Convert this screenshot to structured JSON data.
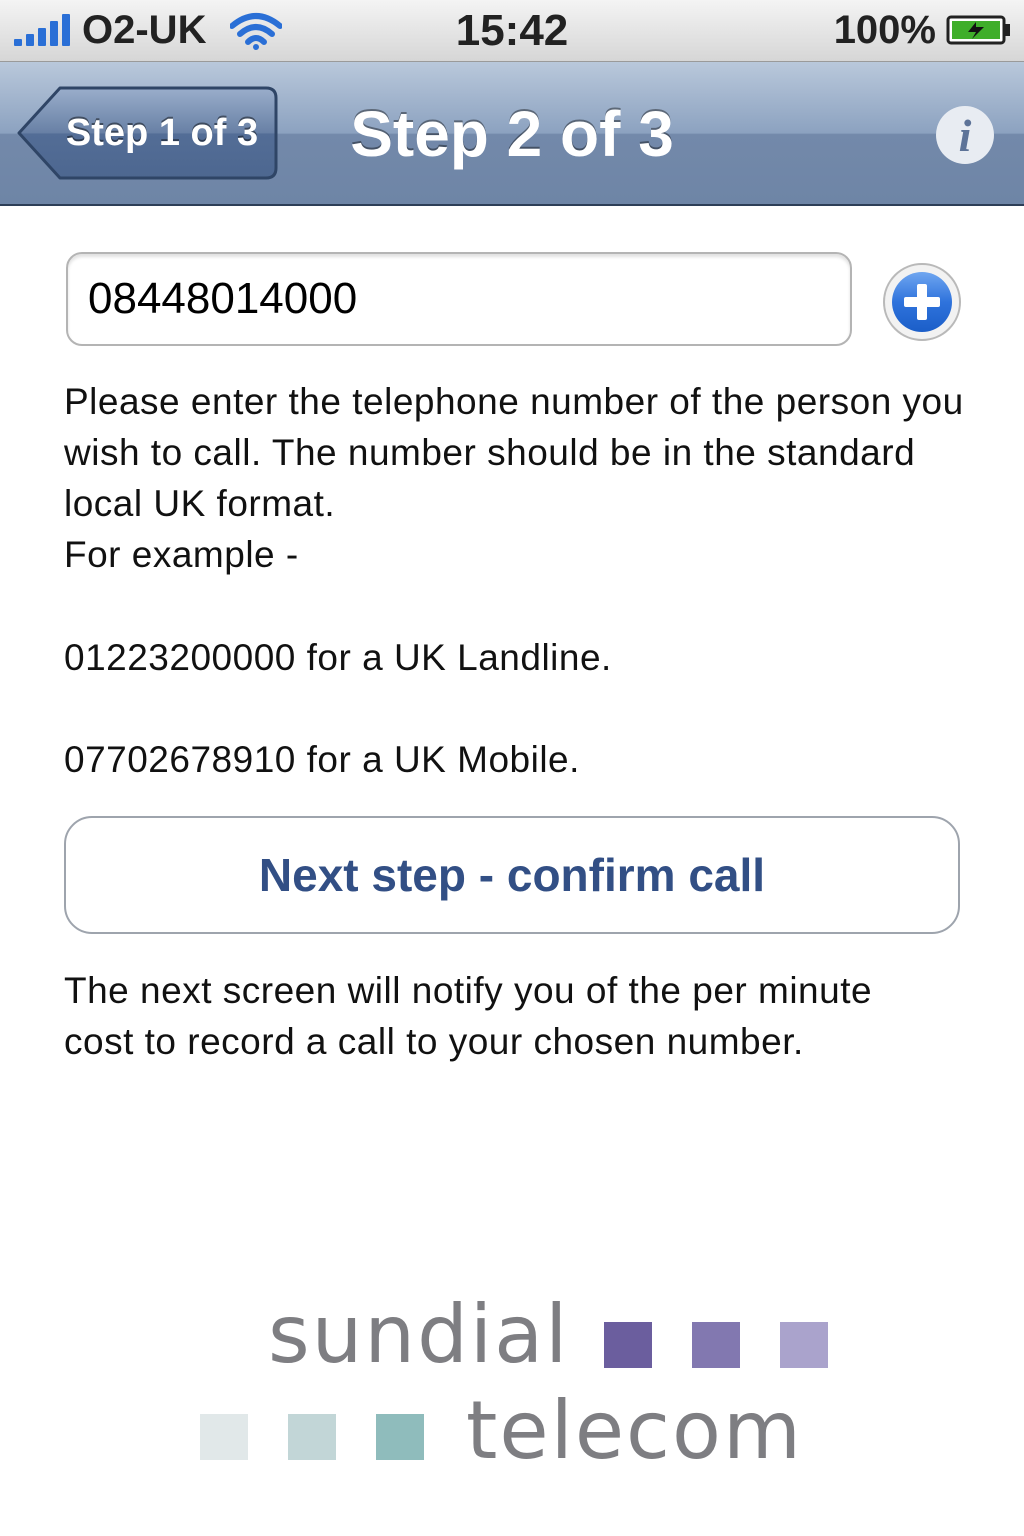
{
  "status_bar": {
    "carrier": "O2-UK",
    "time": "15:42",
    "battery": "100%",
    "icons": [
      "signal-icon",
      "wifi-icon",
      "battery-charging-icon"
    ]
  },
  "nav": {
    "back_label": "Step 1 of 3",
    "title": "Step 2 of 3",
    "info_icon": "info-icon"
  },
  "form": {
    "phone_value": "08448014000",
    "add_icon": "plus-circle-icon"
  },
  "instructions": {
    "intro": "Please enter the telephone number of the person you wish to call. The number should be in the standard local UK format.",
    "example_heading": "For example -",
    "example_landline": "01223200000 for a UK Landline.",
    "example_mobile": "07702678910 for a UK Mobile."
  },
  "next_button": {
    "label": "Next step - confirm call"
  },
  "note": "The next screen will notify you of the per minute cost to record a call to your chosen number.",
  "logo": {
    "word1": "sundial",
    "word2": "telecom",
    "top_square_colors": [
      "#6b5e9e",
      "#8278b0",
      "#aaa3cc"
    ],
    "bottom_square_colors": [
      "#e1e8e9",
      "#c2d6d7",
      "#8fbcbc"
    ]
  },
  "colors": {
    "accent": "#324f85",
    "navbar": "#8ca2c0",
    "signal": "#2a6fd6"
  }
}
